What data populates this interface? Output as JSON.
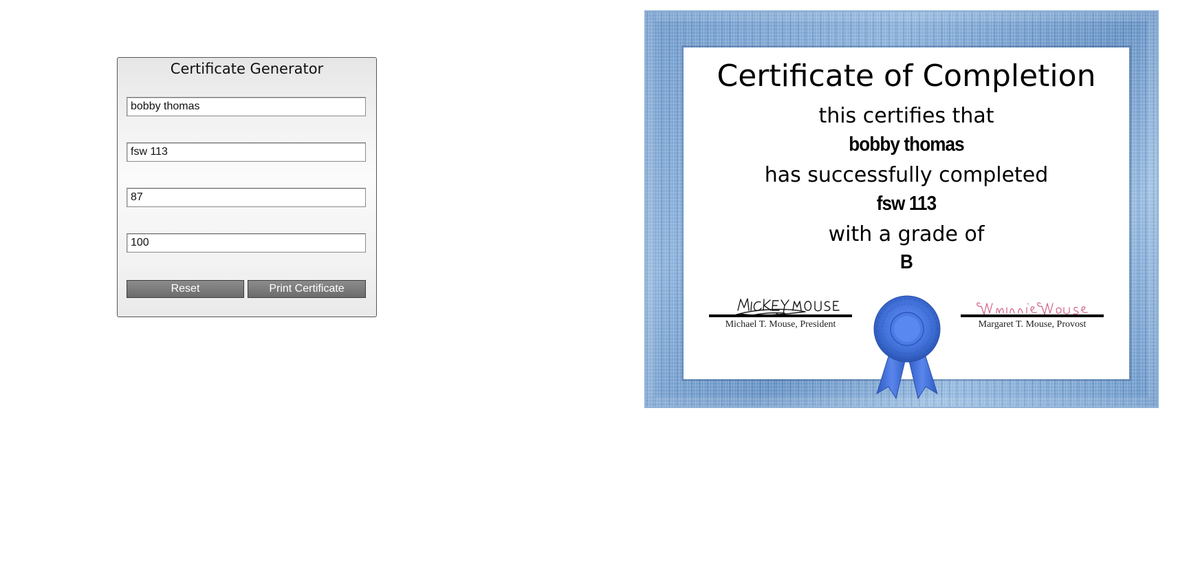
{
  "generator": {
    "title": "Certificate Generator",
    "fields": {
      "student_name": "bobby thomas",
      "course": "fsw 113",
      "points_earned": "87",
      "points_possible": "100"
    },
    "reset_label": "Reset",
    "print_label": "Print Certificate",
    "button_color": "#777777"
  },
  "certificate": {
    "title": "Certificate of Completion",
    "line1": "this certifies that",
    "student_name": "bobby thomas",
    "line2": "has successfully completed",
    "course": "fsw 113",
    "line3": "with a grade of",
    "grade": "B",
    "left_signature": "Mickey Mouse",
    "left_signer": "Michael T. Mouse, President",
    "right_signature": "Minnie Mouse",
    "right_signer": "Margaret T. Mouse, Provost",
    "frame_color": "#7fa6d3",
    "ribbon_color": "#3f6fd6",
    "ribbon_icon": "award-ribbon-icon"
  }
}
